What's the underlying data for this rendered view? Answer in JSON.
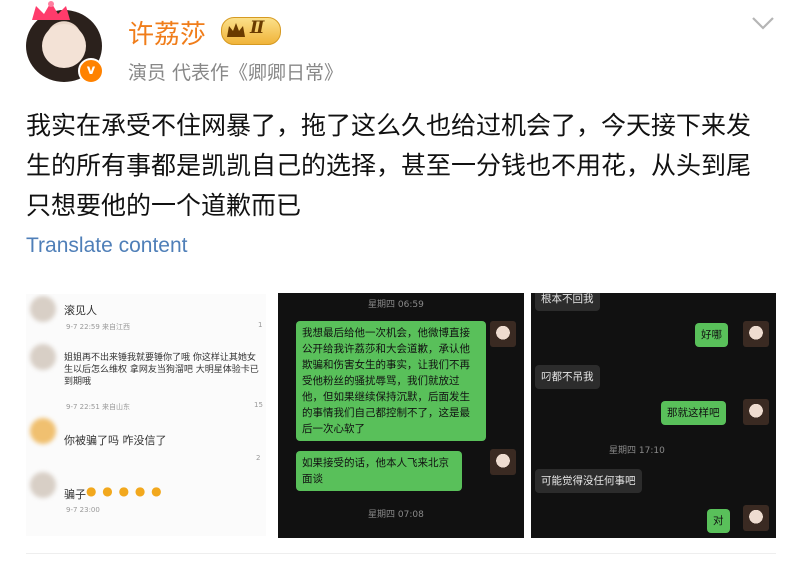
{
  "header": {
    "username": "许荔莎",
    "vip_level": "Ⅱ",
    "meta": "演员 代表作《卿卿日常》",
    "verified_mark": "v"
  },
  "post": {
    "text": "我实在承受不住网暴了，拖了这么久也给过机会了，今天接下来发生的所有事都是凯凯自己的选择，甚至一分钱也不用花，从头到尾只想要他的一个道歉而已",
    "translate_label": "Translate content"
  },
  "image1": {
    "comments": [
      {
        "text": "滚见人",
        "time": "9-7 22:59 来自江西",
        "likes": "1"
      },
      {
        "text": "姐姐再不出来锤我就要锤你了哦 你这样让其她女生以后怎么维权 拿网友当狗溜吧 大明星体验卡已到期哦",
        "time": "9-7 22:51 来自山东",
        "likes": "15"
      },
      {
        "text": "你被骗了吗 咋没信了",
        "time": "",
        "likes": "2"
      },
      {
        "text": "骗子",
        "time": "9-7 23:00",
        "likes": ""
      }
    ]
  },
  "image2": {
    "time_top": "星期四 06:59",
    "msg1": "我想最后给他一次机会，他微博直接公开给我许荔莎和大会道歉，承认他欺骗和伤害女生的事实，让我们不再受他粉丝的骚扰辱骂，我们就放过他，但如果继续保持沉默，后面发生的事情我们自己都控制不了，这是最后一次心软了",
    "msg2": "如果接受的话，他本人飞来北京面谈",
    "time_bottom": "星期四 07:08"
  },
  "image3": {
    "msg_top": "根本不回我",
    "msg_ok": "好哪",
    "msg_ignore": "叼都不吊我",
    "msg_thatsit": "那就这样吧",
    "time_mid": "星期四 17:10",
    "msg_maybe": "可能觉得没任何事吧",
    "msg_yes": "对"
  },
  "colors": {
    "username": "#f07d1a",
    "link": "#4f7fb8",
    "wechat_green": "#59c05a"
  }
}
